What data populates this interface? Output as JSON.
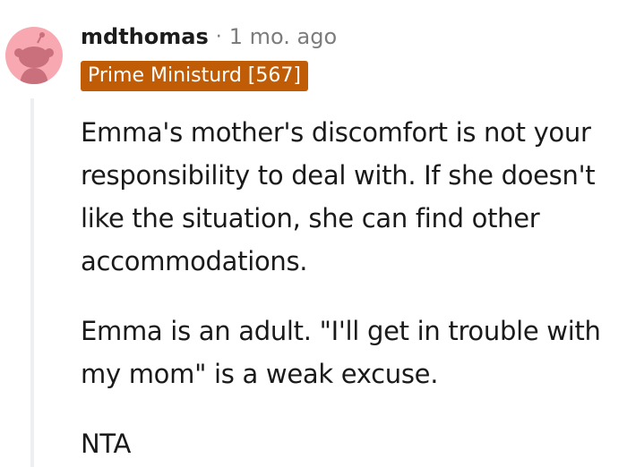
{
  "comment": {
    "username": "mdthomas",
    "separator": "·",
    "timestamp": "1 mo. ago",
    "flair": "Prime Ministurd [567]",
    "paragraphs": [
      "Emma's mother's discomfort is not your responsibility to deal with. If she doesn't like the situation, she can find other accommodations.",
      "Emma is an adult. \"I'll get in trouble with my mom\" is a weak excuse.",
      "NTA"
    ]
  },
  "colors": {
    "flair_bg": "#c15c06",
    "avatar_bg": "#f7a8b0",
    "meta_gray": "#7c7c7c",
    "thread_line": "#edeff1"
  },
  "icons": {
    "avatar": "reddit-snoo-avatar-icon"
  }
}
